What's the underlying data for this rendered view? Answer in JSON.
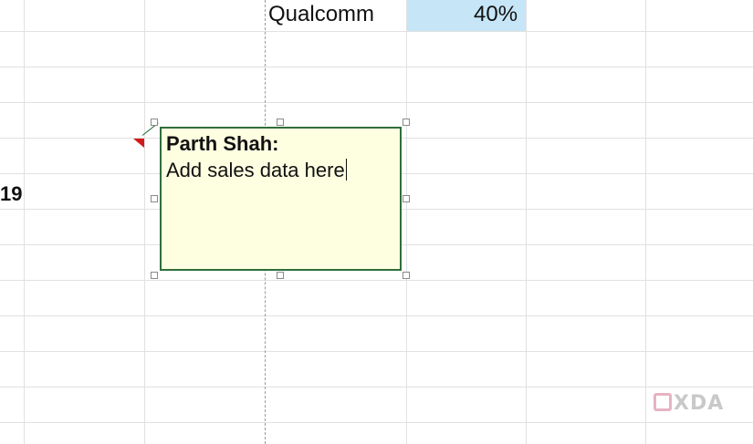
{
  "cells": {
    "company": "Qualcomm",
    "percent": "40%",
    "row_number_partial": "19"
  },
  "comment": {
    "author": "Parth Shah:",
    "text": "Add sales data here"
  },
  "watermark": {
    "text": "XDA"
  },
  "colors": {
    "comment_background": "#fefee1",
    "comment_border": "#2f6e3b",
    "cell_highlight": "#c6e6f7",
    "indicator": "#d11a1a"
  }
}
